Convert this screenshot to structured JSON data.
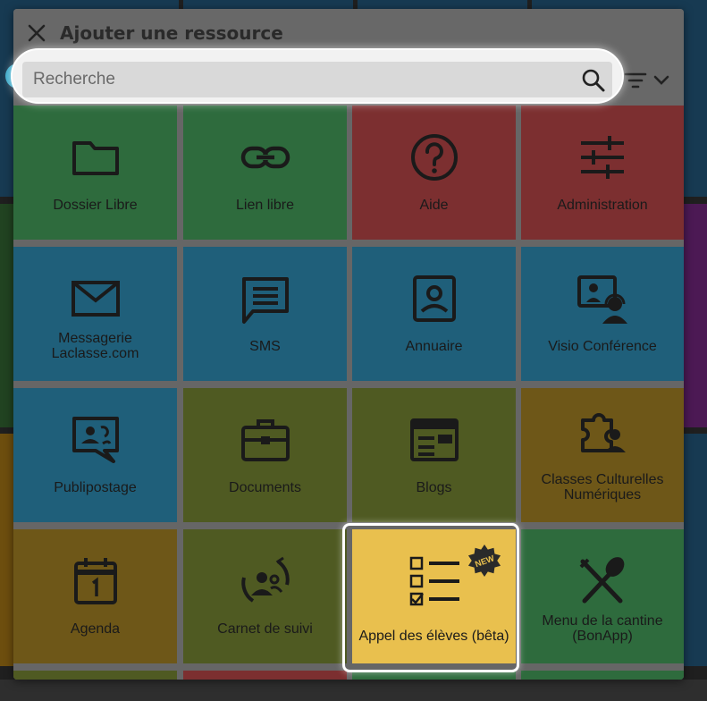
{
  "dialog": {
    "title": "Ajouter une ressource",
    "close_icon": "close-icon",
    "filter_icon": "filter-sort-icon",
    "filter_chevron": "chevron-down-icon"
  },
  "search": {
    "placeholder": "Recherche",
    "value": "",
    "icon": "search-icon"
  },
  "colors": {
    "green": "#2e6b3d",
    "red": "#7c2f30",
    "blue": "#1f5f7a",
    "olive": "#4f5a22",
    "gold": "#6e5718",
    "highlight_yellow": "#e9c04e"
  },
  "tiles": [
    {
      "label": "Dossier Libre",
      "icon": "folder-icon",
      "color": "#2e6b3d"
    },
    {
      "label": "Lien libre",
      "icon": "link-icon",
      "color": "#2e6b3d"
    },
    {
      "label": "Aide",
      "icon": "help-circle-icon",
      "color": "#7c2f30"
    },
    {
      "label": "Administration",
      "icon": "sliders-icon",
      "color": "#7c2f30"
    },
    {
      "label": "Messagerie Laclasse.com",
      "icon": "mail-icon",
      "color": "#1f5f7a"
    },
    {
      "label": "SMS",
      "icon": "message-icon",
      "color": "#1f5f7a"
    },
    {
      "label": "Annuaire",
      "icon": "contact-card-icon",
      "color": "#1f5f7a"
    },
    {
      "label": "Visio Conférence",
      "icon": "video-conference-icon",
      "color": "#1f5f7a"
    },
    {
      "label": "Publipostage",
      "icon": "mailing-icon",
      "color": "#1f5f7a"
    },
    {
      "label": "Documents",
      "icon": "briefcase-icon",
      "color": "#4f5a22"
    },
    {
      "label": "Blogs",
      "icon": "blog-icon",
      "color": "#4f5a22"
    },
    {
      "label": "Classes Culturelles Numériques",
      "icon": "puzzle-user-icon",
      "color": "#6e5718"
    },
    {
      "label": "Agenda",
      "icon": "calendar-icon",
      "color": "#6e5718"
    },
    {
      "label": "Carnet de suivi",
      "icon": "followup-icon",
      "color": "#4f5a22"
    },
    {
      "label": "Appel des élèves (bêta)",
      "icon": "checklist-icon",
      "color": "#e9c04e",
      "badge": "NEW"
    },
    {
      "label": "Menu de la cantine (BonApp)",
      "icon": "utensils-icon",
      "color": "#2e6b3d"
    }
  ]
}
